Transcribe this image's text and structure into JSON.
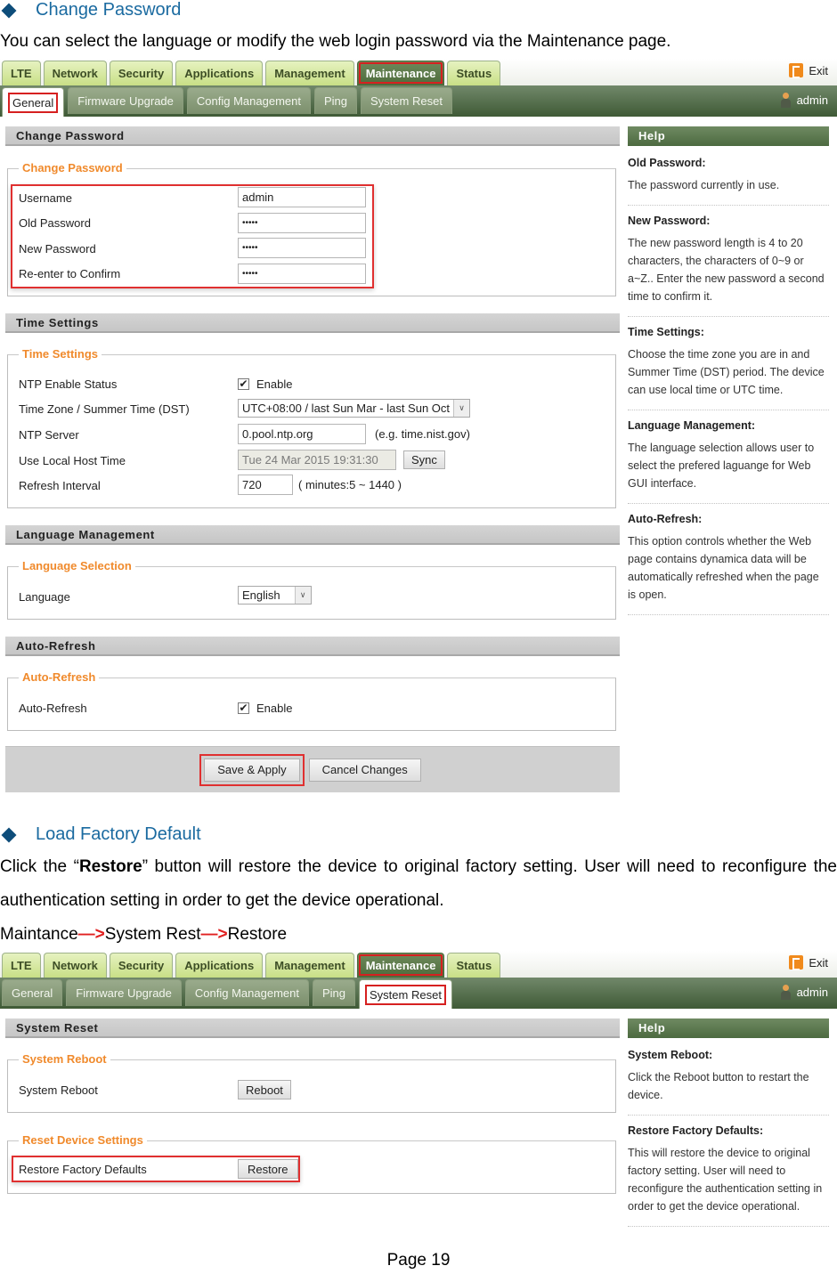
{
  "doc": {
    "section1_title": "Change Password",
    "section1_intro": "You can select the language or modify the web login password via the Maintenance page.",
    "section2_title": "Load Factory Default",
    "section2_p1_pre": "Click the “",
    "section2_p1_bold": "Restore",
    "section2_p1_post": "” button will restore the device to original factory setting. User will need to reconfigure the authentication setting in order to get the device operational.",
    "path_1": "Maintance",
    "path_arrow": "—>",
    "path_2": "System Rest",
    "path_3": "Restore",
    "page_number": "Page 19"
  },
  "nav": {
    "top_tabs": [
      "LTE",
      "Network",
      "Security",
      "Applications",
      "Management",
      "Maintenance",
      "Status"
    ],
    "active_top_tab": "Maintenance",
    "sub_tabs": [
      "General",
      "Firmware Upgrade",
      "Config Management",
      "Ping",
      "System Reset"
    ],
    "exit_label": "Exit",
    "user_label": "admin",
    "icons": {
      "exit": "exit-icon",
      "user": "user-icon"
    }
  },
  "screen1": {
    "active_sub_tab": "General",
    "change_password": {
      "header": "Change Password",
      "legend": "Change Password",
      "fields": [
        {
          "label": "Username",
          "value": "admin"
        },
        {
          "label": "Old Password",
          "value": "•••••"
        },
        {
          "label": "New Password",
          "value": "•••••"
        },
        {
          "label": "Re-enter to Confirm",
          "value": "•••••"
        }
      ]
    },
    "time_settings": {
      "header": "Time Settings",
      "legend": "Time Settings",
      "ntp_enable_label": "NTP Enable Status",
      "ntp_enable_checked": true,
      "ntp_enable_text": "Enable",
      "timezone_label": "Time Zone / Summer Time (DST)",
      "timezone_value": "UTC+08:00 / last Sun Mar - last Sun Oct",
      "ntp_server_label": "NTP Server",
      "ntp_server_value": "0.pool.ntp.org",
      "ntp_server_hint": "(e.g. time.nist.gov)",
      "local_time_label": "Use Local Host Time",
      "local_time_value": "Tue 24 Mar 2015 19:31:30",
      "sync_label": "Sync",
      "refresh_label": "Refresh Interval",
      "refresh_value": "720",
      "refresh_hint": "( minutes:5 ~ 1440 )"
    },
    "language": {
      "header": "Language Management",
      "legend": "Language Selection",
      "label": "Language",
      "value": "English"
    },
    "auto_refresh": {
      "header": "Auto-Refresh",
      "legend": "Auto-Refresh",
      "label": "Auto-Refresh",
      "checked": true,
      "text": "Enable"
    },
    "buttons": {
      "save": "Save & Apply",
      "cancel": "Cancel Changes"
    },
    "help": {
      "header": "Help",
      "items": [
        {
          "title": "Old Password:",
          "body": "The password currently in use."
        },
        {
          "title": "New Password:",
          "body": "The new password length is 4 to 20 characters, the characters of 0~9 or a~Z.. Enter the new password a second time to confirm it."
        },
        {
          "title": "Time Settings:",
          "body": "Choose the time zone you are in and Summer Time (DST) period. The device can use local time or UTC time."
        },
        {
          "title": "Language Management:",
          "body": "The language selection allows user to select the prefered laguange for Web GUI interface."
        },
        {
          "title": "Auto-Refresh:",
          "body": "This option controls whether the Web page contains dynamica data will be automatically refreshed when the page is open."
        }
      ]
    }
  },
  "screen2": {
    "active_sub_tab": "System Reset",
    "header": "System Reset",
    "reboot": {
      "legend": "System Reboot",
      "label": "System Reboot",
      "button": "Reboot"
    },
    "reset": {
      "legend": "Reset Device Settings",
      "label": "Restore Factory Defaults",
      "button": "Restore"
    },
    "help": {
      "header": "Help",
      "items": [
        {
          "title": "System Reboot:",
          "body": "Click the Reboot button to restart the device."
        },
        {
          "title": "Restore Factory Defaults:",
          "body": "This will restore the device to original factory setting. User will need to reconfigure the authentication setting in order to get the device operational."
        }
      ]
    }
  },
  "colors": {
    "heading_blue": "#1a6aa0",
    "legend_orange": "#f08a2c",
    "highlight_red": "#e03030",
    "nav_green": "#4d6a3b",
    "tab_lime": "#c8df86"
  }
}
